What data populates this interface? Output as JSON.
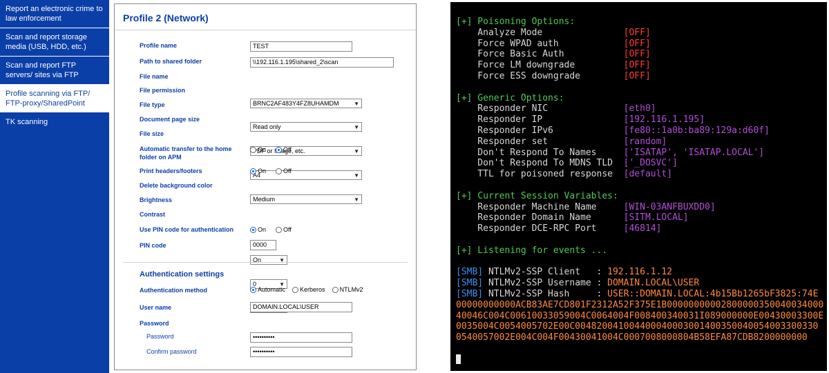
{
  "sidebar": {
    "items": [
      {
        "label": "Report an electronic crime to law enforcement",
        "active": false
      },
      {
        "label": "Scan and report storage media (USB, HDD, etc.)",
        "active": false
      },
      {
        "label": "Scan and report FTP servers/ sites via FTP",
        "active": false
      },
      {
        "label": "Profile scanning via FTP/ FTP-proxy/SharedPoint",
        "active": true
      },
      {
        "label": "TK scanning",
        "active": false
      }
    ]
  },
  "form": {
    "title": "Profile 2 (Network)",
    "profile_name": {
      "label": "Profile name",
      "value": "TEST"
    },
    "path": {
      "label": "Path to shared folder",
      "value": "\\\\192.116.1.195\\shared_2\\scan"
    },
    "file_name": {
      "label": "File name",
      "value": "BRNC2AF483Y4FZ8UHAMDM"
    },
    "file_permission": {
      "label": "File permission",
      "value": "Read only"
    },
    "file_type": {
      "label": "File type",
      "value": "PDF or Image, etc."
    },
    "page_size": {
      "label": "Document page size",
      "value": "A4"
    },
    "file_size": {
      "label": "File size",
      "value": "Medium"
    },
    "auto_transfer": {
      "label": "Automatic transfer to the home folder on APM",
      "on": "On",
      "off": "Off",
      "selected": "Off"
    },
    "print_headers": {
      "label": "Print headers/footers",
      "on": "On",
      "off": "Off",
      "selected": "On"
    },
    "delete_bg": {
      "label": "Delete background color",
      "value": "On"
    },
    "brightness": {
      "label": "Brightness",
      "value": "0"
    },
    "contrast": {
      "label": "Contrast",
      "value": "0"
    },
    "use_pin": {
      "label": "Use PIN code for authentication",
      "on": "On",
      "off": "Off",
      "selected": "On"
    },
    "pin": {
      "label": "PIN code",
      "value": "0000"
    },
    "auth": {
      "title": "Authentication settings",
      "method_label": "Authentication method",
      "methods": [
        "Automatic",
        "Kerberos",
        "NTLMv2"
      ],
      "selected": "Automatic",
      "user_label": "User name",
      "user_value": "DOMAIN.LOCAL\\USER",
      "password_heading": "Password",
      "password_label": "Password",
      "password_value": "••••••••••",
      "confirm_label": "Confirm password",
      "confirm_value": "••••••••••"
    }
  },
  "terminal": {
    "colors": {
      "green": "#4ecb55",
      "red": "#ff3b30",
      "purple": "#b34ed8",
      "blue": "#3b8ff0",
      "orange": "#ff8a3a"
    },
    "poisoning_header": "[+] Poisoning Options:",
    "poisoning": [
      {
        "k": "    Analyze Mode               ",
        "v": "[OFF]"
      },
      {
        "k": "    Force WPAD auth            ",
        "v": "[OFF]"
      },
      {
        "k": "    Force Basic Auth           ",
        "v": "[OFF]"
      },
      {
        "k": "    Force LM downgrade         ",
        "v": "[OFF]"
      },
      {
        "k": "    Force ESS downgrade        ",
        "v": "[OFF]"
      }
    ],
    "generic_header": "[+] Generic Options:",
    "generic": [
      {
        "k": "    Responder NIC              ",
        "v": "[eth0]"
      },
      {
        "k": "    Responder IP               ",
        "v": "[192.116.1.195]"
      },
      {
        "k": "    Responder IPv6             ",
        "v": "[fe80::1a0b:ba89:129a:d60f]"
      },
      {
        "k": "    Responder set              ",
        "v": "[random]"
      },
      {
        "k": "    Don't Respond To Names     ",
        "v": "['ISATAP', 'ISATAP.LOCAL']"
      },
      {
        "k": "    Don't Respond To MDNS TLD  ",
        "v": "['_DOSVC']"
      },
      {
        "k": "    TTL for poisoned response  ",
        "v": "[default]"
      }
    ],
    "session_header": "[+] Current Session Variables:",
    "session": [
      {
        "k": "    Responder Machine Name     ",
        "v": "[WIN-03ANFBUXDD0]"
      },
      {
        "k": "    Responder Domain Name      ",
        "v": "[SITM.LOCAL]"
      },
      {
        "k": "    Responder DCE-RPC Port     ",
        "v": "[46814]"
      }
    ],
    "listening": "[+] Listening for events ...",
    "smb": [
      {
        "tag": "[SMB]",
        "k": " NTLMv2-SSP Client   : ",
        "v": "192.116.1.12"
      },
      {
        "tag": "[SMB]",
        "k": " NTLMv2-SSP Username : ",
        "v": "DOMAIN.LOCAL\\USER"
      },
      {
        "tag": "[SMB]",
        "k": " NTLMv2-SSP Hash     : ",
        "v": "USER::DOMAIN.LOCAL:4b15Bb1265bF3825:74E"
      }
    ],
    "hash_lines": [
      "00000000000ACB83AE7CD801F2312A52F375E1B00000000002800000350040034000",
      "40046C004C00610033059004C0064004F008400340031I089000000E00430003300E",
      "0035004C0054005702E00C004820041004400040003001400350040054003300330",
      "0540057002E004C004F00430041004C0007008000804B58EFA87CDB8200000000"
    ]
  }
}
